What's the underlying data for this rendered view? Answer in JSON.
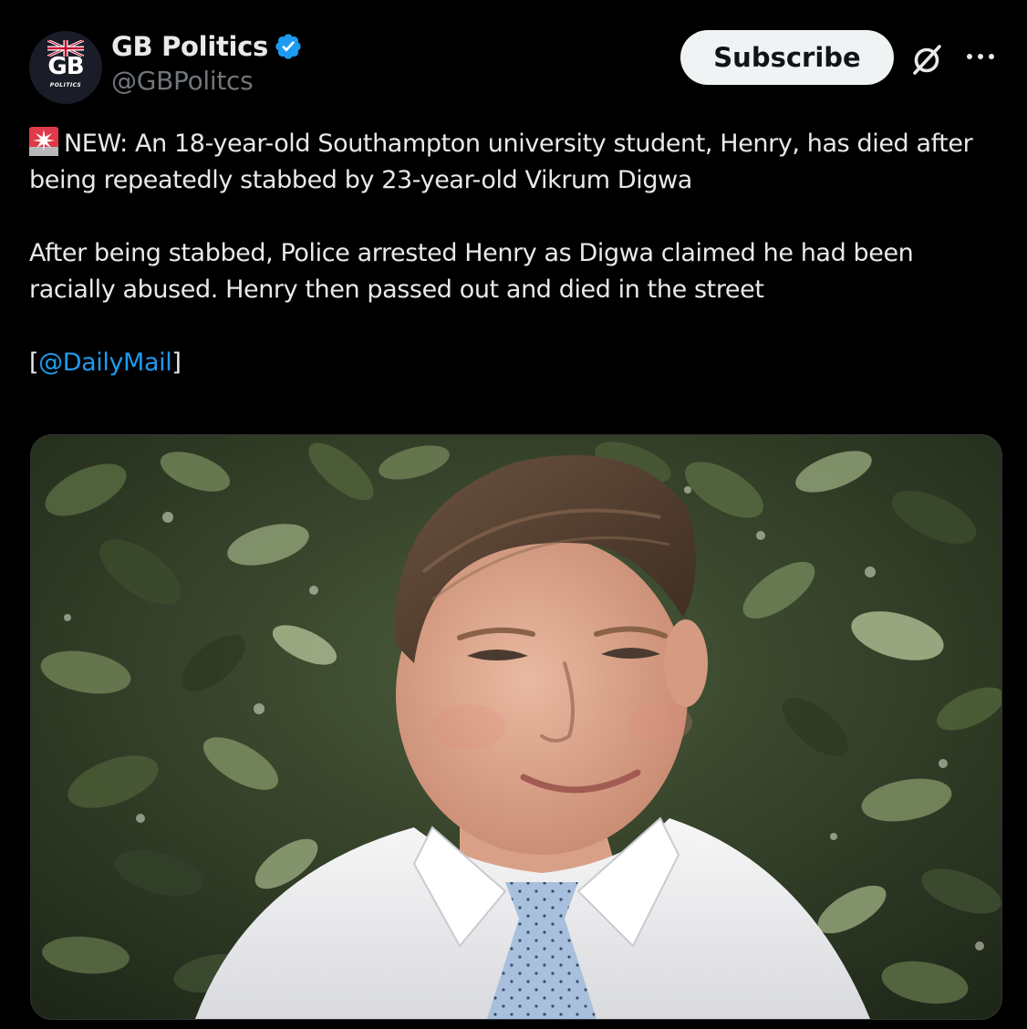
{
  "author": {
    "display_name": "GB Politics",
    "handle": "@GBPolitcs",
    "avatar_text": "GB",
    "avatar_subtext": "POLITICS",
    "verified": true
  },
  "actions": {
    "subscribe_label": "Subscribe",
    "grok_icon": "grok-icon",
    "more_icon": "more-icon"
  },
  "post": {
    "line1_prefix": "NEW: An 18-year-old Southampton university student, Henry, has died after being repeatedly stabbed by 23-year-old Vikrum Digwa",
    "line2": "After being stabbed, Police arrested Henry as Digwa claimed he had been racially abused. Henry then passed out and died in the street",
    "source_open": "[",
    "source_mention": "@DailyMail",
    "source_close": "]",
    "siren_icon": "police-siren-emoji"
  },
  "media": {
    "description_icon": "photo"
  },
  "colors": {
    "background": "#000000",
    "text": "#e7e9ea",
    "secondary": "#71767b",
    "link": "#1d9bf0",
    "verified": "#1d9bf0",
    "button_bg": "#eff3f4"
  }
}
